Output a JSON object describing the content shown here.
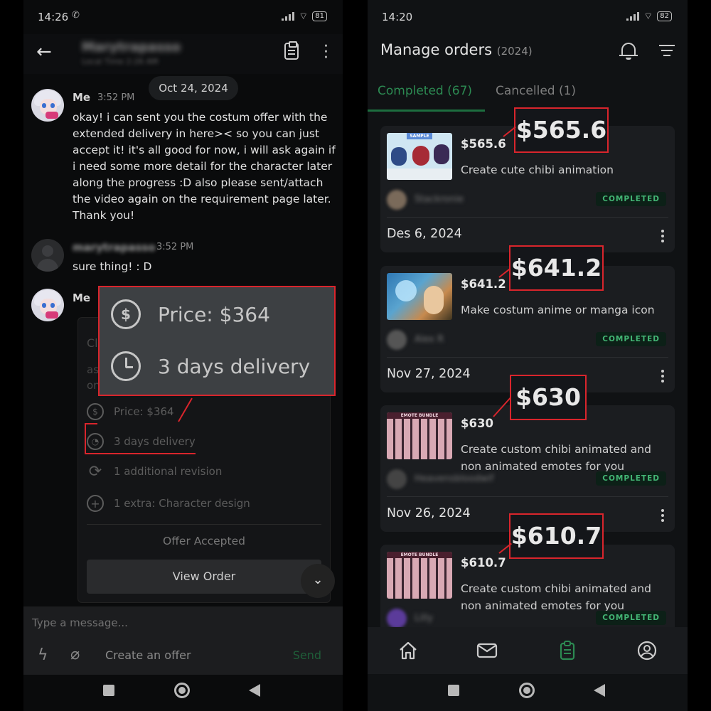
{
  "left_phone": {
    "status": {
      "time": "14:26",
      "battery": "81"
    },
    "header": {
      "contact_name": "Marytrapasso",
      "contact_sub": "Local Time 2:26 AM"
    },
    "date_pill": "Oct 24, 2024",
    "messages": [
      {
        "sender": "Me",
        "time": "3:52 PM",
        "lines": [
          "okay! i can sent you the costum offer with the",
          "extended delivery in here>< so you can just",
          "accept it! it's all good for now, i will ask again if",
          "i need some more detail for the character later",
          "along the progress :D also please sent/attach",
          "the video again on the requirement page later.",
          "Thank you!"
        ]
      },
      {
        "sender": "marytrapasso",
        "time": "3:52 PM",
        "lines": [
          "sure thing! : D"
        ]
      },
      {
        "sender": "Me",
        "time": "",
        "lines": []
      }
    ],
    "offer": {
      "faint_title": "Cl",
      "faint_line1": "as",
      "faint_line2": "on",
      "price": "Price: $364",
      "delivery": "3 days delivery",
      "revision": "1 additional revision",
      "extra": "1 extra: Character design",
      "accepted": "Offer Accepted",
      "view_order": "View Order"
    },
    "zoom": {
      "price": "Price: $364",
      "delivery": "3 days delivery"
    },
    "composer": {
      "placeholder": "Type a message...",
      "create_offer": "Create an offer",
      "send": "Send"
    }
  },
  "right_phone": {
    "status": {
      "time": "14:20",
      "battery": "82"
    },
    "header": {
      "title": "Manage orders",
      "year": "(2024)"
    },
    "tabs": [
      {
        "label": "Completed (67)",
        "active": true
      },
      {
        "label": "Cancelled (1)",
        "active": false
      }
    ],
    "orders": [
      {
        "price": "$565.6",
        "title": "Create cute chibi animation",
        "buyer": "Stackronie",
        "status": "COMPLETED",
        "date": "Des 6, 2024",
        "callout": "$565.6",
        "thumb_label": "SAMPLE"
      },
      {
        "price": "$641.2",
        "title": "Make costum anime or manga icon",
        "buyer": "Alex R",
        "status": "COMPLETED",
        "date": "Nov 27, 2024",
        "callout": "$641.2",
        "thumb_label": ""
      },
      {
        "price": "$630",
        "title": "Create custom chibi animated and non animated emotes for you",
        "buyer": "Heavensbloodwif",
        "status": "COMPLETED",
        "date": "Nov 26, 2024",
        "callout": "$630",
        "thumb_label": "EMOTE BUNDLE"
      },
      {
        "price": "$610.7",
        "title": "Create custom chibi animated and non animated emotes for you",
        "buyer": "Lilly",
        "status": "COMPLETED",
        "date": "",
        "callout": "$610.7",
        "thumb_label": "EMOTE BUNDLE"
      }
    ]
  },
  "colors": {
    "accent_green": "#2c8a52",
    "highlight_red": "#d9252c",
    "badge_green": "#43b574"
  },
  "icons": [
    "back-arrow-icon",
    "clipboard-icon",
    "more-vert-icon",
    "dollar-icon",
    "clock-icon",
    "refresh-icon",
    "plus-circle-icon",
    "chevron-down-icon",
    "bolt-icon",
    "paperclip-icon",
    "bell-icon",
    "filter-icon",
    "home-icon",
    "mail-icon",
    "orders-icon",
    "profile-icon"
  ]
}
